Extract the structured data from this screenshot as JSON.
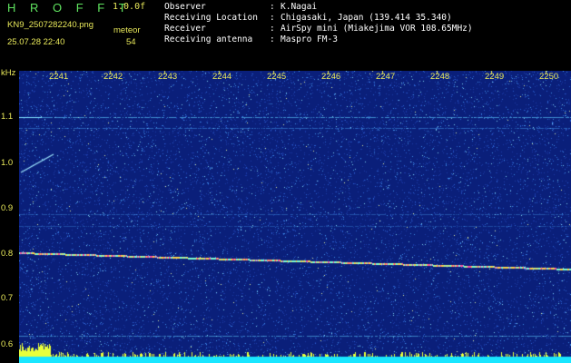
{
  "header": {
    "app_title": "H R O F F T",
    "version": "1.0.0f",
    "filename": "KN9_2507282240.png",
    "meteor_label": "meteor",
    "datetime": "25.07.28 22:40",
    "meteor_count": "54",
    "info": [
      {
        "key": "Observer",
        "value": "K.Nagai"
      },
      {
        "key": "Receiving Location",
        "value": "Chigasaki, Japan (139.414 35.340)"
      },
      {
        "key": "Receiver",
        "value": "AirSpy mini (Miakejima VOR 108.65MHz)"
      },
      {
        "key": "Receiving antenna",
        "value": "Maspro FM-3"
      }
    ],
    "separator": ":"
  },
  "axes": {
    "y_unit": "kHz",
    "y_ticks": [
      "1.1",
      "1.0",
      "0.9",
      "0.8",
      "0.7",
      "0.6"
    ],
    "x_ticks": [
      "2241",
      "2242",
      "2243",
      "2244",
      "2245",
      "2246",
      "2247",
      "2248",
      "2249",
      "2250"
    ]
  },
  "colors": {
    "background_noise": "#0a1f7a",
    "header_text": "#e8e85a",
    "title": "#5fe35f",
    "signal": "#ffd24a",
    "baseline": "#19e6ff"
  }
}
